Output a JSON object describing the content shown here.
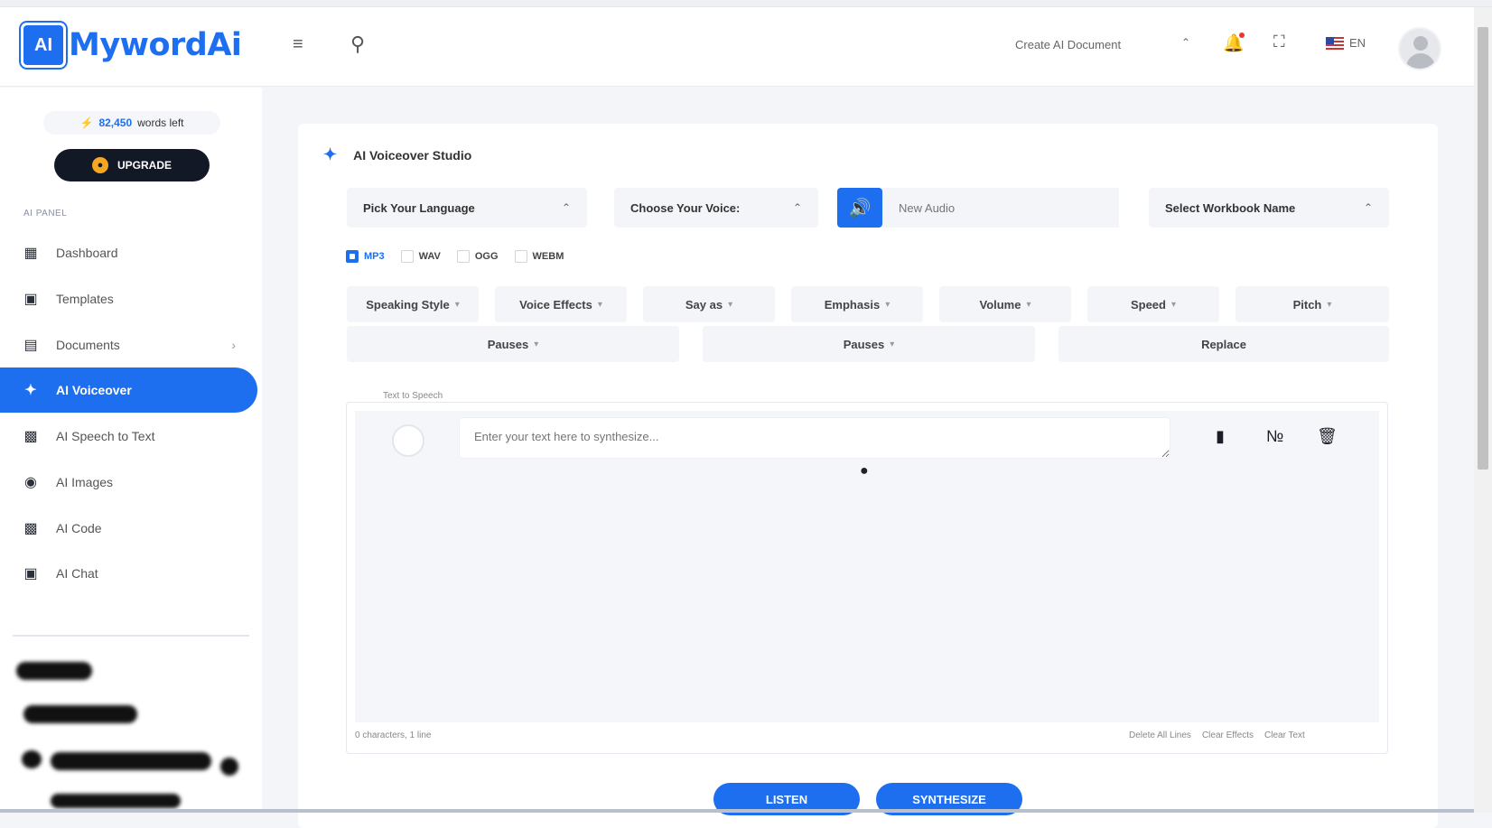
{
  "brand": {
    "chip": "AI",
    "name": "MywordAi"
  },
  "header": {
    "menu_icon": "menu-icon",
    "search_icon": "search-icon",
    "create_document": "Create AI Document",
    "language": "EN"
  },
  "sidebar": {
    "words_count": "82,450",
    "words_suffix": "words left",
    "upgrade_label": "UPGRADE",
    "panel_label": "AI PANEL",
    "items": [
      {
        "label": "Dashboard",
        "icon": "dashboard-icon"
      },
      {
        "label": "Templates",
        "icon": "templates-icon"
      },
      {
        "label": "Documents",
        "icon": "documents-icon"
      },
      {
        "label": "AI Voiceover",
        "icon": "voiceover-icon"
      },
      {
        "label": "AI Speech to Text",
        "icon": "speech-to-text-icon"
      },
      {
        "label": "AI Images",
        "icon": "images-icon"
      },
      {
        "label": "AI Code",
        "icon": "code-icon"
      },
      {
        "label": "AI Chat",
        "icon": "chat-icon"
      }
    ]
  },
  "studio": {
    "title": "AI Voiceover Studio",
    "language_select": "Pick Your Language",
    "voice_select": "Choose Your Voice:",
    "audio_placeholder": "New Audio",
    "workbook_select": "Select Workbook Name",
    "formats": [
      {
        "label": "MP3",
        "checked": true
      },
      {
        "label": "WAV",
        "checked": false
      },
      {
        "label": "OGG",
        "checked": false
      },
      {
        "label": "WEBM",
        "checked": false
      }
    ],
    "effects_row1": [
      "Speaking Style",
      "Voice Effects",
      "Say as",
      "Emphasis",
      "Volume",
      "Speed",
      "Pitch"
    ],
    "effects_row2": [
      "Pauses",
      "Pauses",
      "Replace"
    ],
    "tts_legend": "Text to Speech",
    "text_placeholder": "Enter your text here to synthesize...",
    "char_count": "0 characters, 1 line",
    "footer_links": [
      "Delete All Lines",
      "Clear Effects",
      "Clear Text"
    ],
    "listen_label": "LISTEN",
    "synthesize_label": "SYNTHESIZE"
  },
  "colors": {
    "accent": "#1e6ff0",
    "dark": "#121826",
    "surface": "#f3f5f9"
  }
}
